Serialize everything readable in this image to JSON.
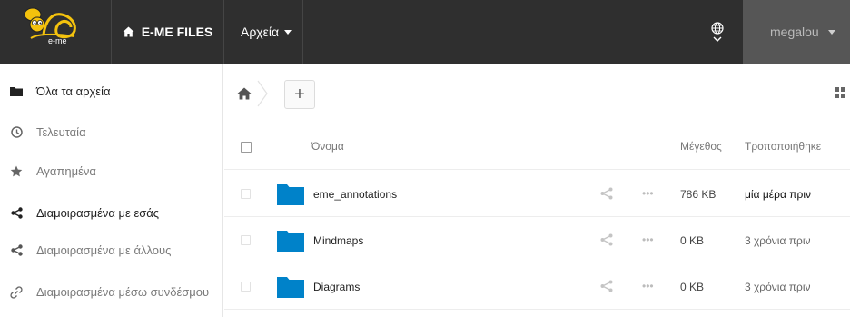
{
  "app": {
    "logo_text": "e-me",
    "brand_label": "E-ME FILES"
  },
  "topnav": {
    "files_menu_label": "Αρχεία",
    "username": "megalou"
  },
  "sidebar": {
    "items": [
      {
        "label": "Όλα τα αρχεία",
        "icon": "folder-icon"
      },
      {
        "label": "Τελευταία",
        "icon": "clock-icon"
      },
      {
        "label": "Αγαπημένα",
        "icon": "star-icon"
      },
      {
        "label": "Διαμοιρασμένα με εσάς",
        "icon": "share-icon"
      },
      {
        "label": "Διαμοιρασμένα με άλλους",
        "icon": "share-icon"
      },
      {
        "label": "Διαμοιρασμένα μέσω συνδέσμου",
        "icon": "link-icon"
      }
    ]
  },
  "controls": {
    "new_button_label": "+"
  },
  "table": {
    "headers": {
      "name": "Όνομα",
      "size": "Μέγεθος",
      "modified": "Τροποποιήθηκε"
    },
    "rows": [
      {
        "name": "eme_annotations",
        "size": "786 KB",
        "modified": "μία μέρα πριν",
        "more": "•••"
      },
      {
        "name": "Mindmaps",
        "size": "0 KB",
        "modified": "3 χρόνια πριν",
        "more": "•••"
      },
      {
        "name": "Diagrams",
        "size": "0 KB",
        "modified": "3 χρόνια πριν",
        "more": "•••"
      }
    ]
  },
  "colors": {
    "topbar": "#2f2f2f",
    "user_area": "#565656",
    "folder": "#0082c9",
    "logo_yellow": "#f4c20d"
  }
}
